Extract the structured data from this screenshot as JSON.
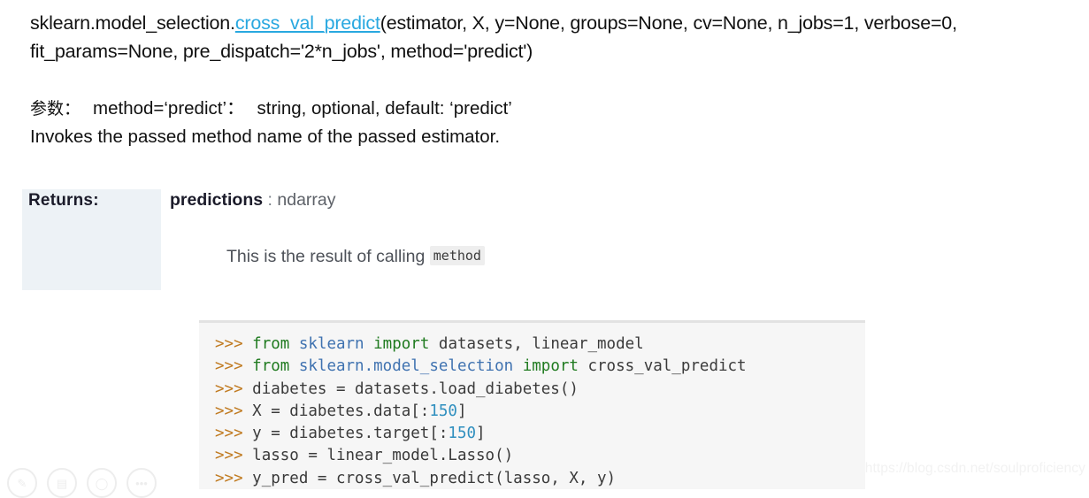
{
  "signature": {
    "prefix": "sklearn.model_selection.",
    "function_name": "cross_val_predict",
    "args_line1": "(estimator, X, y=None, groups=None, cv=None, n_jobs=1, verbose=0,",
    "args_line2": "fit_params=None, pre_dispatch='2*n_jobs', method='predict')",
    "link_color": "#29a8e0"
  },
  "params": {
    "label_cjk": "参数：",
    "line1": "method=‘predict’：",
    "line1_desc": "string, optional, default: ‘predict’",
    "line2": "Invokes the passed method name of the passed estimator."
  },
  "returns": {
    "label": "Returns:",
    "name": "predictions",
    "separator": ":",
    "type": "ndarray",
    "description_prefix": "This is the result of calling",
    "description_code": "method",
    "panel_color": "#edf2f6"
  },
  "code": {
    "prompt": ">>>",
    "lines": [
      [
        {
          "t": ">>> ",
          "c": "prompt"
        },
        {
          "t": "from ",
          "c": "kw"
        },
        {
          "t": "sklearn ",
          "c": "mod"
        },
        {
          "t": "import ",
          "c": "kw"
        },
        {
          "t": "datasets, linear_model",
          "c": "plain"
        }
      ],
      [
        {
          "t": ">>> ",
          "c": "prompt"
        },
        {
          "t": "from ",
          "c": "kw"
        },
        {
          "t": "sklearn.model_selection ",
          "c": "mod"
        },
        {
          "t": "import ",
          "c": "kw"
        },
        {
          "t": "cross_val_predict",
          "c": "plain"
        }
      ],
      [
        {
          "t": ">>> ",
          "c": "prompt"
        },
        {
          "t": "diabetes = datasets.load_diabetes()",
          "c": "plain"
        }
      ],
      [
        {
          "t": ">>> ",
          "c": "prompt"
        },
        {
          "t": "X = diabetes.data[:",
          "c": "plain"
        },
        {
          "t": "150",
          "c": "num"
        },
        {
          "t": "]",
          "c": "plain"
        }
      ],
      [
        {
          "t": ">>> ",
          "c": "prompt"
        },
        {
          "t": "y = diabetes.target[:",
          "c": "plain"
        },
        {
          "t": "150",
          "c": "num"
        },
        {
          "t": "]",
          "c": "plain"
        }
      ],
      [
        {
          "t": ">>> ",
          "c": "prompt"
        },
        {
          "t": "lasso = linear_model.Lasso()",
          "c": "plain"
        }
      ],
      [
        {
          "t": ">>> ",
          "c": "prompt"
        },
        {
          "t": "y_pred = cross_val_predict(lasso, X, y)",
          "c": "plain"
        }
      ]
    ]
  },
  "watermark": {
    "text": "https://blog.csdn.net/soulproficiency"
  },
  "icon_strip": {
    "items": [
      {
        "name": "pencil-icon",
        "glyph": "✎"
      },
      {
        "name": "image-icon",
        "glyph": "▤"
      },
      {
        "name": "circle-icon",
        "glyph": "◯"
      },
      {
        "name": "more-icon",
        "glyph": "•••"
      }
    ]
  }
}
